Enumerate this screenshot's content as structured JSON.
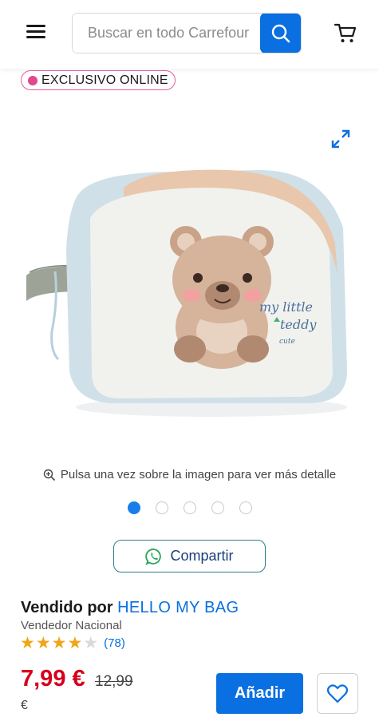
{
  "header": {
    "search_placeholder": "Buscar en todo Carrefour"
  },
  "badge": {
    "label": "EXCLUSIVO ONLINE"
  },
  "gallery": {
    "hint": "Pulsa una vez sobre la imagen para ver más detalle",
    "dot_count": 5,
    "active_index": 0
  },
  "share": {
    "label": "Compartir"
  },
  "seller": {
    "prefix": "Vendido por",
    "name": "HELLO MY BAG",
    "type": "Vendedor Nacional"
  },
  "rating": {
    "stars": 4,
    "max": 5,
    "count": "(78)"
  },
  "pricing": {
    "price": "7,99 €",
    "old_price": "12,99",
    "old_price_currency": "€"
  },
  "actions": {
    "add_label": "Añadir"
  },
  "colors": {
    "brand_blue": "#0a6fe0",
    "price_red": "#d6001c",
    "badge_pink": "#e0478e"
  }
}
